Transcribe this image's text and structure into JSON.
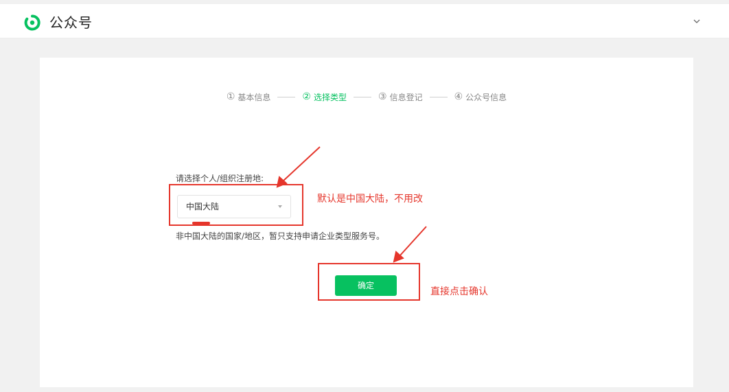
{
  "header": {
    "brand": "公众号",
    "logo_icon": "wechat-official-account-logo-icon",
    "menu_icon": "chevron-down-icon",
    "accent": "#07c160"
  },
  "steps": [
    {
      "num": "①",
      "label": "基本信息",
      "active": false
    },
    {
      "num": "②",
      "label": "选择类型",
      "active": true
    },
    {
      "num": "③",
      "label": "信息登记",
      "active": false
    },
    {
      "num": "④",
      "label": "公众号信息",
      "active": false
    }
  ],
  "form": {
    "region_label": "请选择个人/组织注册地:",
    "region_value": "中国大陆",
    "hint": "非中国大陆的国家/地区，暂只支持申请企业类型服务号。",
    "confirm_label": "确定"
  },
  "annotations": {
    "note_region": "默认是中国大陆，不用改",
    "note_confirm": "直接点击确认",
    "color": "#e5352b"
  }
}
